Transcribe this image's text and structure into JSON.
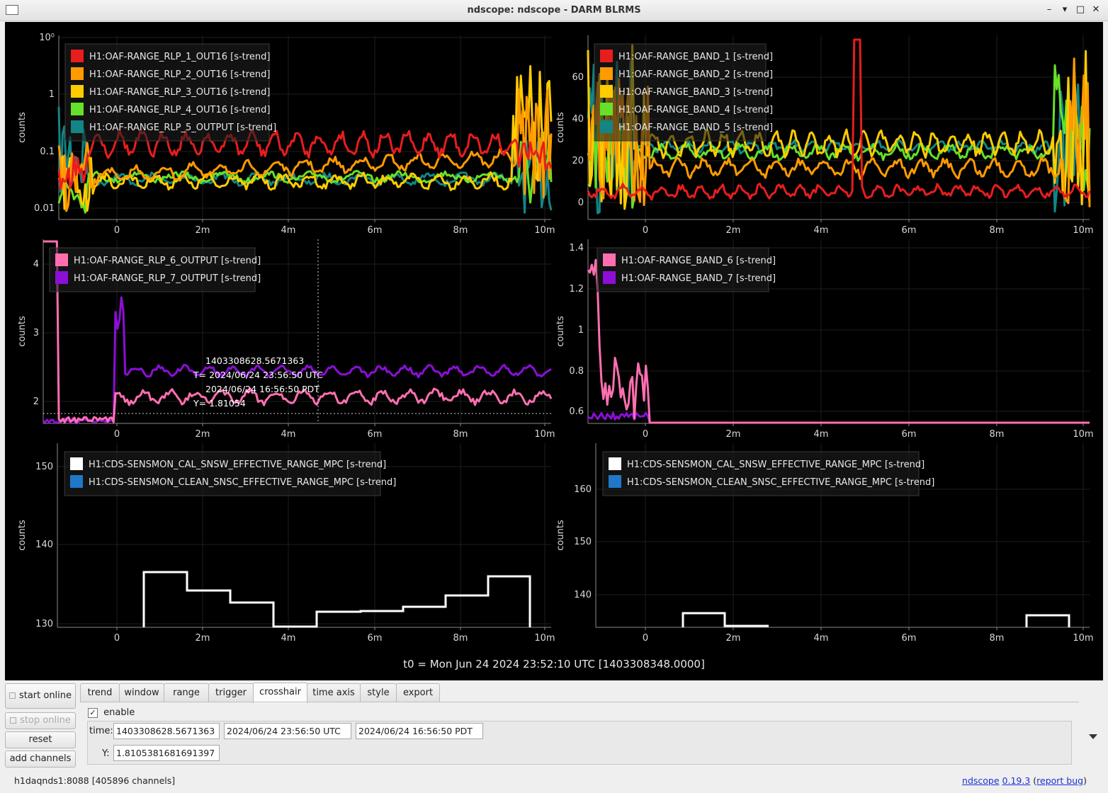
{
  "window": {
    "title": "ndscope: ndscope - DARM BLRMS",
    "minimize_glyph": "–",
    "restore_glyph": "▾",
    "maximize_glyph": "□",
    "close_glyph": "✕"
  },
  "plots": {
    "x_ticks": [
      "0",
      "2m",
      "4m",
      "6m",
      "8m",
      "10m"
    ],
    "y_label": "counts",
    "p1": {
      "y_scale": "log",
      "y_ticks": [
        "10⁰",
        "1",
        "0.1",
        "0.01"
      ],
      "legend": [
        {
          "label": "H1:OAF-RANGE_RLP_1_OUT16 [s-trend]",
          "color": "#e81d1d"
        },
        {
          "label": "H1:OAF-RANGE_RLP_2_OUT16 [s-trend]",
          "color": "#ff9a00"
        },
        {
          "label": "H1:OAF-RANGE_RLP_3_OUT16 [s-trend]",
          "color": "#ffcc00"
        },
        {
          "label": "H1:OAF-RANGE_RLP_4_OUT16 [s-trend]",
          "color": "#66e02a"
        },
        {
          "label": "H1:OAF-RANGE_RLP_5_OUTPUT [s-trend]",
          "color": "#138585"
        }
      ]
    },
    "p2": {
      "y_ticks": [
        "60",
        "40",
        "20",
        "0"
      ],
      "legend": [
        {
          "label": "H1:OAF-RANGE_BAND_1 [s-trend]",
          "color": "#e81d1d"
        },
        {
          "label": "H1:OAF-RANGE_BAND_2 [s-trend]",
          "color": "#ff9a00"
        },
        {
          "label": "H1:OAF-RANGE_BAND_3 [s-trend]",
          "color": "#ffcc00"
        },
        {
          "label": "H1:OAF-RANGE_BAND_4 [s-trend]",
          "color": "#66e02a"
        },
        {
          "label": "H1:OAF-RANGE_BAND_5 [s-trend]",
          "color": "#138585"
        }
      ]
    },
    "p3": {
      "y_ticks": [
        "4",
        "3",
        "2"
      ],
      "legend": [
        {
          "label": "H1:OAF-RANGE_RLP_6_OUTPUT [s-trend]",
          "color": "#ff6fb0"
        },
        {
          "label": "H1:OAF-RANGE_RLP_7_OUTPUT [s-trend]",
          "color": "#8b0fd6"
        }
      ],
      "crosshair": {
        "gps": "1403308628.5671363",
        "t_utc": "T= 2024/06/24 23:56:50 UTC",
        "t_pdt": "2024/06/24 16:56:50 PDT",
        "y": "Y= 1.81054"
      }
    },
    "p4": {
      "y_ticks": [
        "1.4",
        "1.2",
        "1",
        "0.8",
        "0.6"
      ],
      "legend": [
        {
          "label": "H1:OAF-RANGE_BAND_6 [s-trend]",
          "color": "#ff6fb0"
        },
        {
          "label": "H1:OAF-RANGE_BAND_7 [s-trend]",
          "color": "#8b0fd6"
        }
      ]
    },
    "p5": {
      "y_ticks": [
        "150",
        "140",
        "130"
      ],
      "legend": [
        {
          "label": "H1:CDS-SENSMON_CAL_SNSW_EFFECTIVE_RANGE_MPC [s-trend]",
          "color": "#ffffff"
        },
        {
          "label": "H1:CDS-SENSMON_CLEAN_SNSC_EFFECTIVE_RANGE_MPC [s-trend]",
          "color": "#1f78c8"
        }
      ]
    },
    "p6": {
      "y_ticks": [
        "160",
        "150",
        "140"
      ],
      "legend": [
        {
          "label": "H1:CDS-SENSMON_CAL_SNSW_EFFECTIVE_RANGE_MPC [s-trend]",
          "color": "#ffffff"
        },
        {
          "label": "H1:CDS-SENSMON_CLEAN_SNSC_EFFECTIVE_RANGE_MPC [s-trend]",
          "color": "#1f78c8"
        }
      ]
    },
    "t0": "t0 = Mon Jun 24 2024 23:52:10 UTC [1403308348.0000]"
  },
  "controls": {
    "start_online": "start online",
    "stop_online": "stop online",
    "reset": "reset",
    "add_channels": "add channels",
    "tabs": [
      "trend",
      "window",
      "range",
      "trigger",
      "crosshair",
      "time axis",
      "style",
      "export"
    ],
    "active_tab": "crosshair",
    "enable_label": "enable",
    "enable_checked": "✓",
    "time_label": "time:",
    "time_gps": "1403308628.5671363",
    "time_utc": "2024/06/24 23:56:50 UTC",
    "time_pdt": "2024/06/24 16:56:50 PDT",
    "y_label": "Y:",
    "y_value": "1.8105381681691397"
  },
  "status": {
    "server": "h1daqnds1:8088  [405896 channels]",
    "app_link": "ndscope",
    "version_link": "0.19.3",
    "report_prefix": " (",
    "report_link": "report bug",
    "report_suffix": ")"
  }
}
